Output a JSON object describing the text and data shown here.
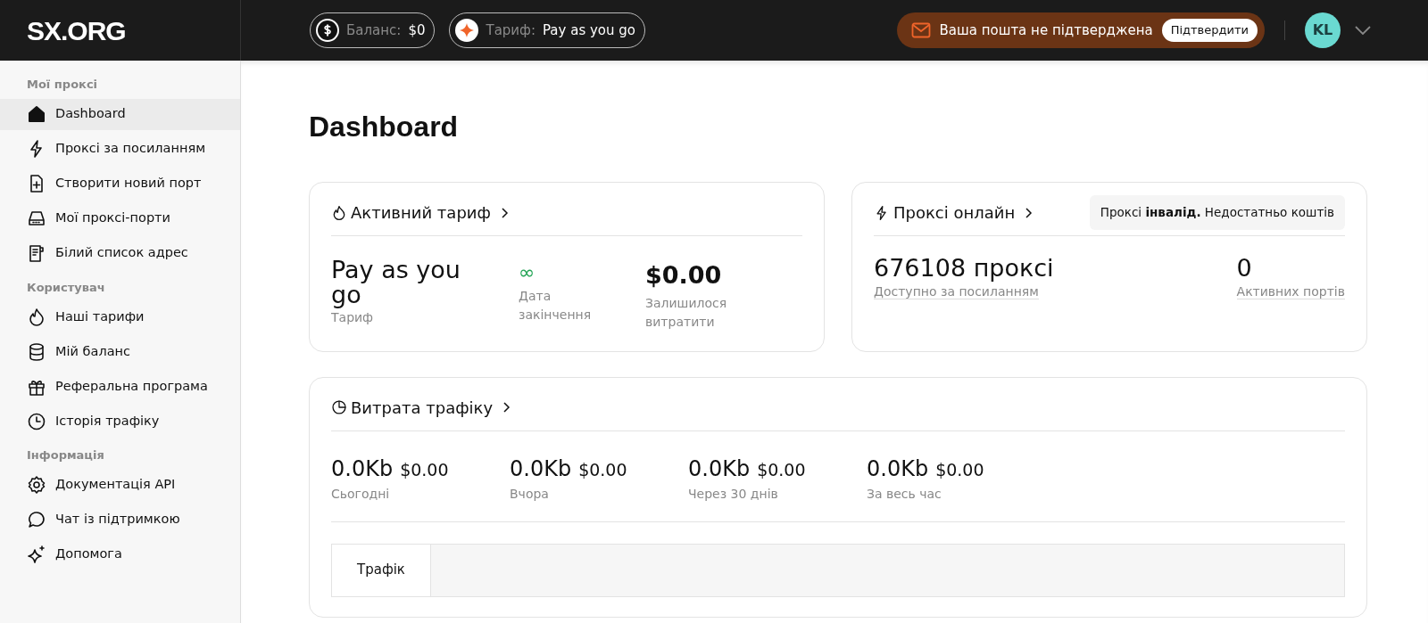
{
  "header": {
    "logo": "SX.ORG",
    "balance": {
      "label": "Баланс:",
      "value": "$0"
    },
    "tariff": {
      "label": "Тариф:",
      "value": "Pay as you go"
    },
    "notice": {
      "text": "Ваша пошта не підтверджена",
      "button": "Підтвердити"
    },
    "avatar": "KL"
  },
  "sidebar": {
    "sections": [
      {
        "title": "Мої проксі",
        "items": [
          {
            "label": "Dashboard",
            "selected": true
          },
          {
            "label": "Проксі за посиланням",
            "selected": false
          },
          {
            "label": "Створити новий порт",
            "selected": false
          },
          {
            "label": "Мої проксі-порти",
            "selected": false
          },
          {
            "label": "Білий список адрес",
            "selected": false
          }
        ]
      },
      {
        "title": "Користувач",
        "items": [
          {
            "label": "Наші тарифи",
            "selected": false
          },
          {
            "label": "Мій баланс",
            "selected": false
          },
          {
            "label": "Реферальна програма",
            "selected": false
          },
          {
            "label": "Історія трафіку",
            "selected": false
          }
        ]
      },
      {
        "title": "Інформація",
        "items": [
          {
            "label": "Документація API",
            "selected": false
          },
          {
            "label": "Чат із підтримкою",
            "selected": false
          },
          {
            "label": "Допомога",
            "selected": false
          }
        ]
      }
    ]
  },
  "page_title": "Dashboard",
  "active_tariff": {
    "title": "Активний тариф",
    "stats": [
      {
        "value": "Pay as you go",
        "label": "Тариф",
        "kind": "plain"
      },
      {
        "value": "∞",
        "label": "Дата закінчення",
        "kind": "infinity"
      },
      {
        "value": "$0.00",
        "label": "Залишилося витратити",
        "kind": "bold"
      }
    ]
  },
  "proxy_online": {
    "title": "Проксі онлайн",
    "notice": "Проксі **інвалід.** Недостатньо коштів",
    "stats": [
      {
        "value": "676108 проксі",
        "label": "Доступно за посиланням"
      },
      {
        "value": "0",
        "label": "Активних портів"
      }
    ]
  },
  "traffic": {
    "title": "Витрата трафіку",
    "stats": [
      {
        "amount": "0.0Kb",
        "cost": "$0.00",
        "label": "Сьогодні"
      },
      {
        "amount": "0.0Kb",
        "cost": "$0.00",
        "label": "Вчора"
      },
      {
        "amount": "0.0Kb",
        "cost": "$0.00",
        "label": "Через 30 днів"
      },
      {
        "amount": "0.0Kb",
        "cost": "$0.00",
        "label": "За весь час"
      }
    ],
    "tabs": [
      {
        "label": "Трафік",
        "selected": true
      }
    ]
  }
}
